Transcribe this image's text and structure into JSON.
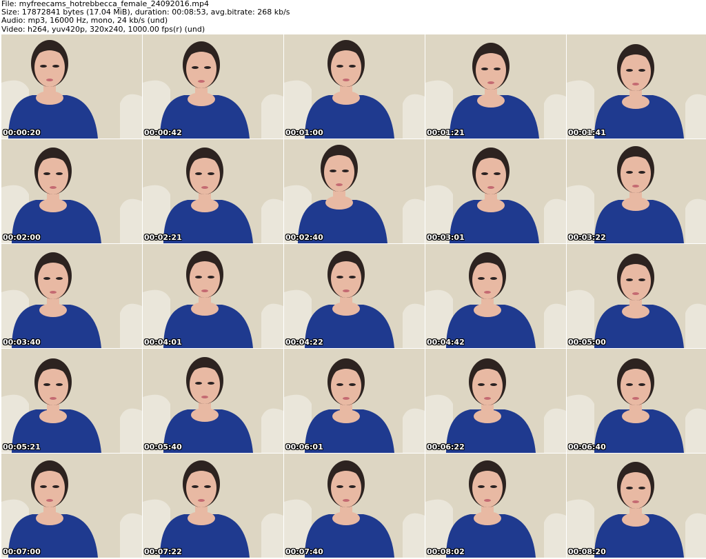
{
  "header": {
    "file_line": "File: myfreecams_hotrebbecca_female_24092016.mp4",
    "size_line": "Size: 17872841 bytes (17.04 MiB), duration: 00:08:53, avg.bitrate: 268 kb/s",
    "audio_line": "Audio: mp3, 16000 Hz, mono, 24 kb/s (und)",
    "video_line": "Video: h264, yuv420p, 320x240, 1000.00 fps(r) (und)"
  },
  "thumbnails": [
    {
      "timestamp": "00:00:20"
    },
    {
      "timestamp": "00:00:42"
    },
    {
      "timestamp": "00:01:00"
    },
    {
      "timestamp": "00:01:21"
    },
    {
      "timestamp": "00:01:41"
    },
    {
      "timestamp": "00:02:00"
    },
    {
      "timestamp": "00:02:21"
    },
    {
      "timestamp": "00:02:40"
    },
    {
      "timestamp": "00:03:01"
    },
    {
      "timestamp": "00:03:22"
    },
    {
      "timestamp": "00:03:40"
    },
    {
      "timestamp": "00:04:01"
    },
    {
      "timestamp": "00:04:22"
    },
    {
      "timestamp": "00:04:42"
    },
    {
      "timestamp": "00:05:00"
    },
    {
      "timestamp": "00:05:21"
    },
    {
      "timestamp": "00:05:40"
    },
    {
      "timestamp": "00:06:01"
    },
    {
      "timestamp": "00:06:22"
    },
    {
      "timestamp": "00:06:40"
    },
    {
      "timestamp": "00:07:00"
    },
    {
      "timestamp": "00:07:22"
    },
    {
      "timestamp": "00:07:40"
    },
    {
      "timestamp": "00:08:02"
    },
    {
      "timestamp": "00:08:20"
    }
  ],
  "colors": {
    "background": "#ffffff",
    "header_text": "#000000",
    "wall": "#ddd6c3",
    "sofa": "#eeeae0",
    "top": "#1f3a8f",
    "skin": "#e8b9a3",
    "hair": "#2d2320",
    "timestamp_text": "#ffffff"
  }
}
